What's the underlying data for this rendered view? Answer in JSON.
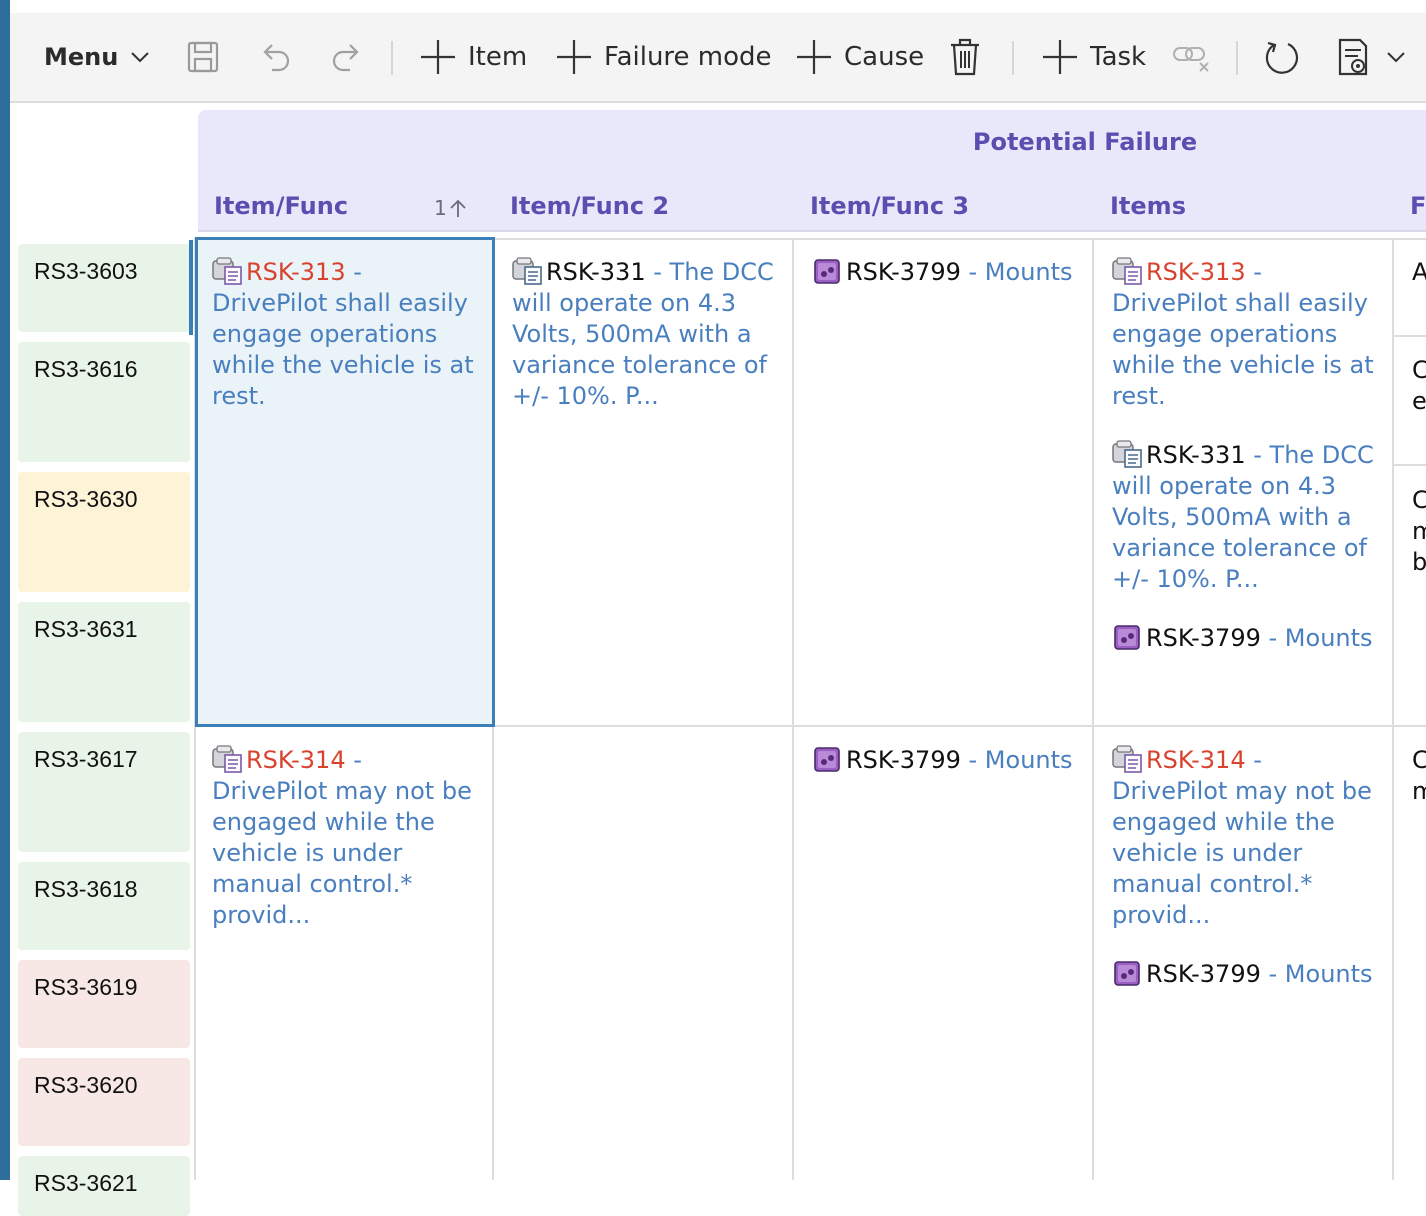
{
  "toolbar": {
    "menu_label": "Menu",
    "add_item_label": "Item",
    "add_failure_mode_label": "Failure mode",
    "add_cause_label": "Cause",
    "add_task_label": "Task"
  },
  "header": {
    "group_title": "Potential Failure",
    "columns": [
      "Item/Func",
      "Item/Func 2",
      "Item/Func 3",
      "Items",
      "Fa"
    ],
    "sort_indicator": "1"
  },
  "ids": [
    "RS3-3603",
    "RS3-3616",
    "RS3-3630",
    "RS3-3631",
    "RS3-3617",
    "RS3-3618",
    "RS3-3619",
    "RS3-3620",
    "RS3-3621"
  ],
  "rows": [
    {
      "item_func": [
        {
          "id": "RSK-313",
          "sep": " - ",
          "desc": "DrivePilot shall easily engage operations while the vehicle is at rest."
        }
      ],
      "item_func_2": [
        {
          "id": "RSK-331",
          "sep": " - ",
          "desc": "The DCC will operate on 4.3 Volts, 500mA with a variance tolerance of +/- 10%. P..."
        }
      ],
      "item_func_3": [
        {
          "id": "RSK-3799",
          "sep": " - ",
          "desc": "Mounts"
        }
      ],
      "items": [
        {
          "id": "RSK-313",
          "sep": " - ",
          "desc": "DrivePilot shall easily engage operations while the vehicle is at rest."
        },
        {
          "id": "RSK-331",
          "sep": " - ",
          "desc": "The DCC will operate on 4.3 Volts, 500mA with a variance tolerance of +/- 10%. P..."
        },
        {
          "id": "RSK-3799",
          "sep": " - ",
          "desc": "Mounts"
        }
      ],
      "fa_clip": [
        "A",
        "C",
        "e",
        "C",
        "m",
        "b"
      ]
    },
    {
      "item_func": [
        {
          "id": "RSK-314",
          "sep": " - ",
          "desc": "DrivePilot may not be engaged while the vehicle is under manual control.* provid..."
        }
      ],
      "item_func_3": [
        {
          "id": "RSK-3799",
          "sep": " - ",
          "desc": "Mounts"
        }
      ],
      "items": [
        {
          "id": "RSK-314",
          "sep": " - ",
          "desc": "DrivePilot may not be engaged while the vehicle is under manual control.* provid..."
        },
        {
          "id": "RSK-3799",
          "sep": " - ",
          "desc": "Mounts"
        }
      ],
      "fa_clip": [
        "C",
        "m"
      ]
    }
  ]
}
